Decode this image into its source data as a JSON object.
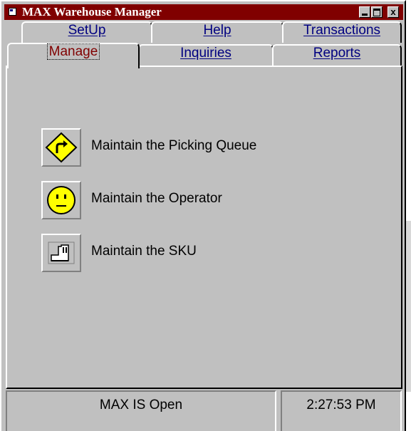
{
  "window": {
    "title": "MAX Warehouse Manager",
    "controls": {
      "minimize": "minimize",
      "maximize": "maximize",
      "close": "x"
    }
  },
  "tabs": {
    "row1": [
      {
        "label": "SetUp",
        "accel": "S"
      },
      {
        "label": "Help",
        "accel": "H"
      },
      {
        "label": "Transactions",
        "accel": "T"
      }
    ],
    "row2": [
      {
        "label": "Manage",
        "accel": "M",
        "active": true
      },
      {
        "label": "Inquiries",
        "accel": "I"
      },
      {
        "label": "Reports",
        "accel": "R"
      }
    ]
  },
  "manage": {
    "items": [
      {
        "label": "Maintain the Picking Queue",
        "icon": "turn-sign-icon"
      },
      {
        "label": "Maintain the Operator",
        "icon": "smiley-face-icon"
      },
      {
        "label": "Maintain the SKU",
        "icon": "factory-icon"
      }
    ]
  },
  "status": {
    "message": "MAX IS Open",
    "time": "2:27:53 PM"
  },
  "colors": {
    "title_bar": "#800000",
    "face": "#c0c0c0",
    "tab_text": "#000080",
    "active_tab_text": "#800000",
    "sign_yellow": "#ffff00"
  }
}
